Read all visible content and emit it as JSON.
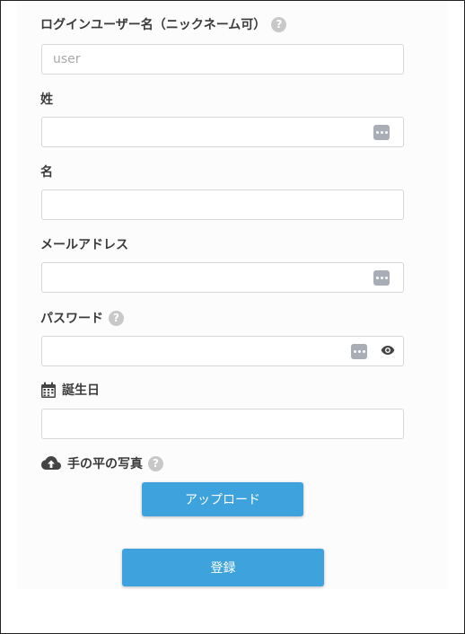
{
  "form": {
    "username": {
      "label": "ログインユーザー名（ニックネーム可）",
      "placeholder": "user",
      "value": ""
    },
    "last_name": {
      "label": "姓",
      "value": ""
    },
    "first_name": {
      "label": "名",
      "value": ""
    },
    "email": {
      "label": "メールアドレス",
      "value": ""
    },
    "password": {
      "label": "パスワード",
      "value": ""
    },
    "birthday": {
      "label": "誕生日",
      "value": ""
    },
    "palm_photo": {
      "label": "手の平の写真",
      "upload_label": "アップロード"
    },
    "submit_label": "登録"
  },
  "help_glyph": "?",
  "colors": {
    "primary": "#3ea2dc",
    "help_icon": "#c8c8c8",
    "autofill_icon": "#a9adb5"
  },
  "icons": [
    "help-icon",
    "autofill-icon",
    "eye-icon",
    "calendar-icon",
    "cloud-upload-icon"
  ]
}
